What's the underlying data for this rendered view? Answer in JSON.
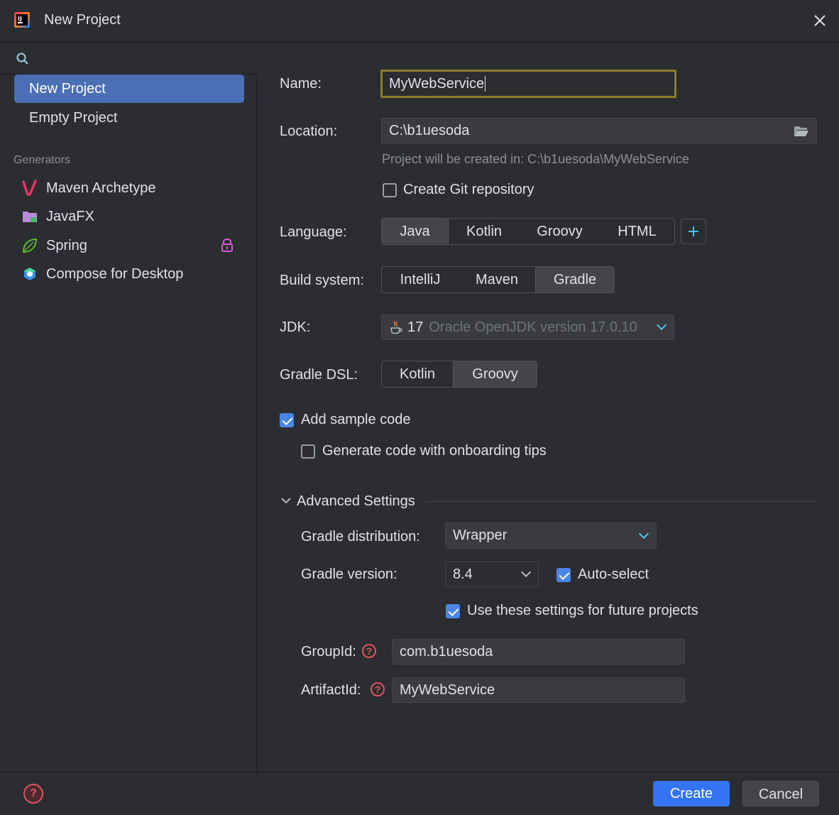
{
  "window": {
    "title": "New Project"
  },
  "sidebar": {
    "search_placeholder": "",
    "items": [
      {
        "label": "New Project",
        "selected": true
      },
      {
        "label": "Empty Project",
        "selected": false
      }
    ],
    "generators_header": "Generators",
    "generators": [
      {
        "label": "Maven Archetype",
        "icon": "maven-icon"
      },
      {
        "label": "JavaFX",
        "icon": "javafx-folder-icon"
      },
      {
        "label": "Spring",
        "icon": "spring-leaf-icon",
        "locked": true
      },
      {
        "label": "Compose for Desktop",
        "icon": "compose-icon"
      }
    ]
  },
  "form": {
    "name_label": "Name:",
    "name_value": "MyWebService",
    "location_label": "Location:",
    "location_value": "C:\\b1uesoda",
    "location_hint": "Project will be created in: C:\\b1uesoda\\MyWebService",
    "create_git_label": "Create Git repository",
    "create_git_checked": false,
    "language_label": "Language:",
    "languages": [
      "Java",
      "Kotlin",
      "Groovy",
      "HTML"
    ],
    "language_selected": "Java",
    "build_label": "Build system:",
    "build_systems": [
      "IntelliJ",
      "Maven",
      "Gradle"
    ],
    "build_selected": "Gradle",
    "jdk_label": "JDK:",
    "jdk_version": "17",
    "jdk_desc": "Oracle OpenJDK version 17.0.10",
    "dsl_label": "Gradle DSL:",
    "dsl_options": [
      "Kotlin",
      "Groovy"
    ],
    "dsl_selected": "Groovy",
    "sample_code_label": "Add sample code",
    "sample_code_checked": true,
    "onboarding_label": "Generate code with onboarding tips",
    "onboarding_checked": false
  },
  "advanced": {
    "header": "Advanced Settings",
    "distribution_label": "Gradle distribution:",
    "distribution_value": "Wrapper",
    "version_label": "Gradle version:",
    "version_value": "8.4",
    "autoselect_label": "Auto-select",
    "autoselect_checked": true,
    "future_label": "Use these settings for future projects",
    "future_checked": true,
    "groupid_label": "GroupId:",
    "groupid_value": "com.b1uesoda",
    "artifactid_label": "ArtifactId:",
    "artifactid_value": "MyWebService"
  },
  "footer": {
    "help": "?",
    "create": "Create",
    "cancel": "Cancel"
  },
  "colors": {
    "accent": "#3574f0",
    "selection": "#4a6fb5",
    "focus_border": "#8a7f2a",
    "help_red": "#e05463"
  }
}
